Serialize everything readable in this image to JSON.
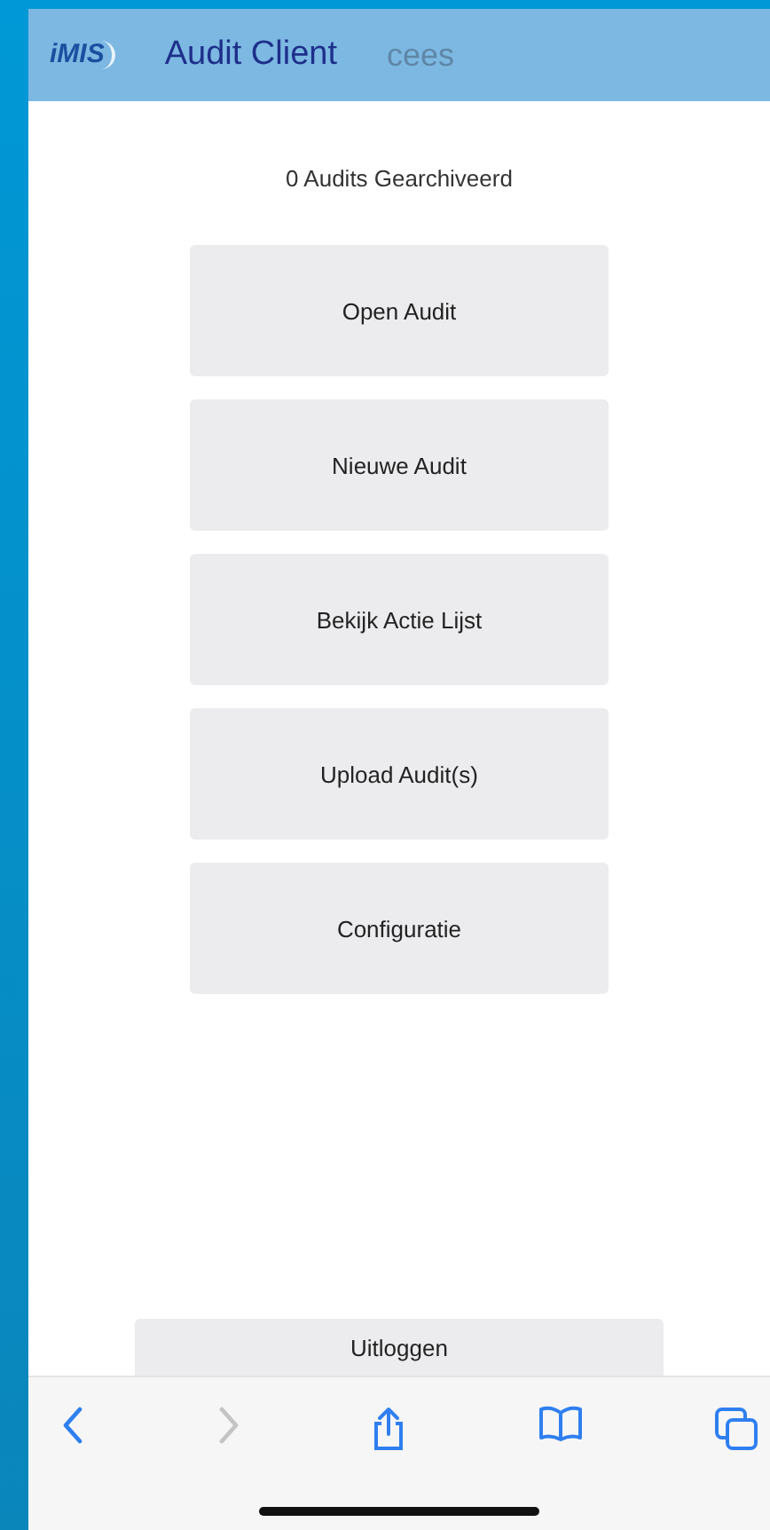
{
  "header": {
    "logo": "iMIS",
    "title": "Audit Client",
    "user": "cees"
  },
  "archived_count": "0 Audits Gearchiveerd",
  "menu_buttons": [
    "Open Audit",
    "Nieuwe Audit",
    "Bekijk Actie Lijst",
    "Upload Audit(s)",
    "Configuratie"
  ],
  "logout_button": "Uitloggen",
  "toolbar": [
    {
      "kind": "back",
      "disabled": false
    },
    {
      "kind": "forward",
      "disabled": true
    },
    {
      "kind": "share",
      "disabled": false
    },
    {
      "kind": "bookmarks",
      "disabled": false
    },
    {
      "kind": "tabs",
      "disabled": false
    }
  ]
}
